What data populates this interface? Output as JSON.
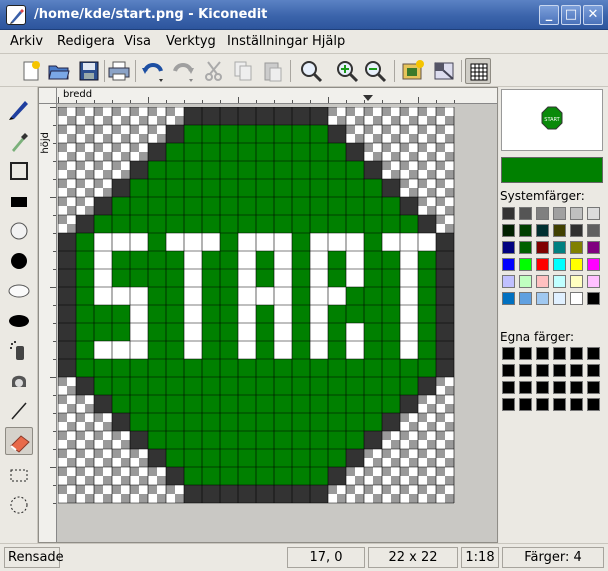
{
  "window": {
    "title": "/home/kde/start.png - Kiconedit",
    "buttons": {
      "minimize": "_",
      "maximize": "□",
      "close": "✕"
    }
  },
  "menu": [
    "Arkiv",
    "Redigera",
    "Visa",
    "Verktyg",
    "Inställningar",
    "Hjälp"
  ],
  "toolbar_icons": [
    "new-icon",
    "open-icon",
    "save-icon",
    "print-icon",
    "undo-icon",
    "redo-icon",
    "cut-icon",
    "copy-icon",
    "paste-icon",
    "zoom-icon",
    "zoom-in-icon",
    "zoom-out-icon",
    "import-icon",
    "properties-icon",
    "grid-icon"
  ],
  "left_tools": [
    "freehand-icon",
    "eyedropper-icon",
    "rectangle-icon",
    "filled-rectangle-icon",
    "circle-icon",
    "filled-circle-icon",
    "ellipse-icon",
    "filled-ellipse-icon",
    "spray-icon",
    "fill-icon",
    "line-icon",
    "eraser-icon",
    "select-rect-icon",
    "select-circle-icon"
  ],
  "rulers": {
    "horizontal": "bredd",
    "vertical": "höjd"
  },
  "watermark": "Kiconedit",
  "preview_text": "START",
  "current_color": "#008000",
  "panel": {
    "system_colors_label": "Systemfärger:",
    "custom_colors_label": "Egna färger:",
    "system_colors": [
      "#333333",
      "#555555",
      "#808080",
      "#a0a0a0",
      "#c0c0c0",
      "#dcdcdc",
      "#002000",
      "#004000",
      "#003030",
      "#404000",
      "#303030",
      "#606060",
      "#000080",
      "#006000",
      "#800000",
      "#008080",
      "#808000",
      "#800080",
      "#0000ff",
      "#00ff00",
      "#ff0000",
      "#00ffff",
      "#ffff00",
      "#ff00ff",
      "#c0c0ff",
      "#c0ffc0",
      "#ffc0c0",
      "#c0ffff",
      "#ffffc0",
      "#ffc0ff",
      "#0070c0",
      "#60a0e0",
      "#a0c8f0",
      "#e0f0ff",
      "#ffffff",
      "#000000"
    ],
    "custom_colors_count": 24
  },
  "icon_size": {
    "w": 22,
    "h": 22
  },
  "status": {
    "message": "Rensade",
    "position": "17, 0",
    "size": "22 x 22",
    "zoom": "1:18",
    "colors": "Färger: 4"
  }
}
